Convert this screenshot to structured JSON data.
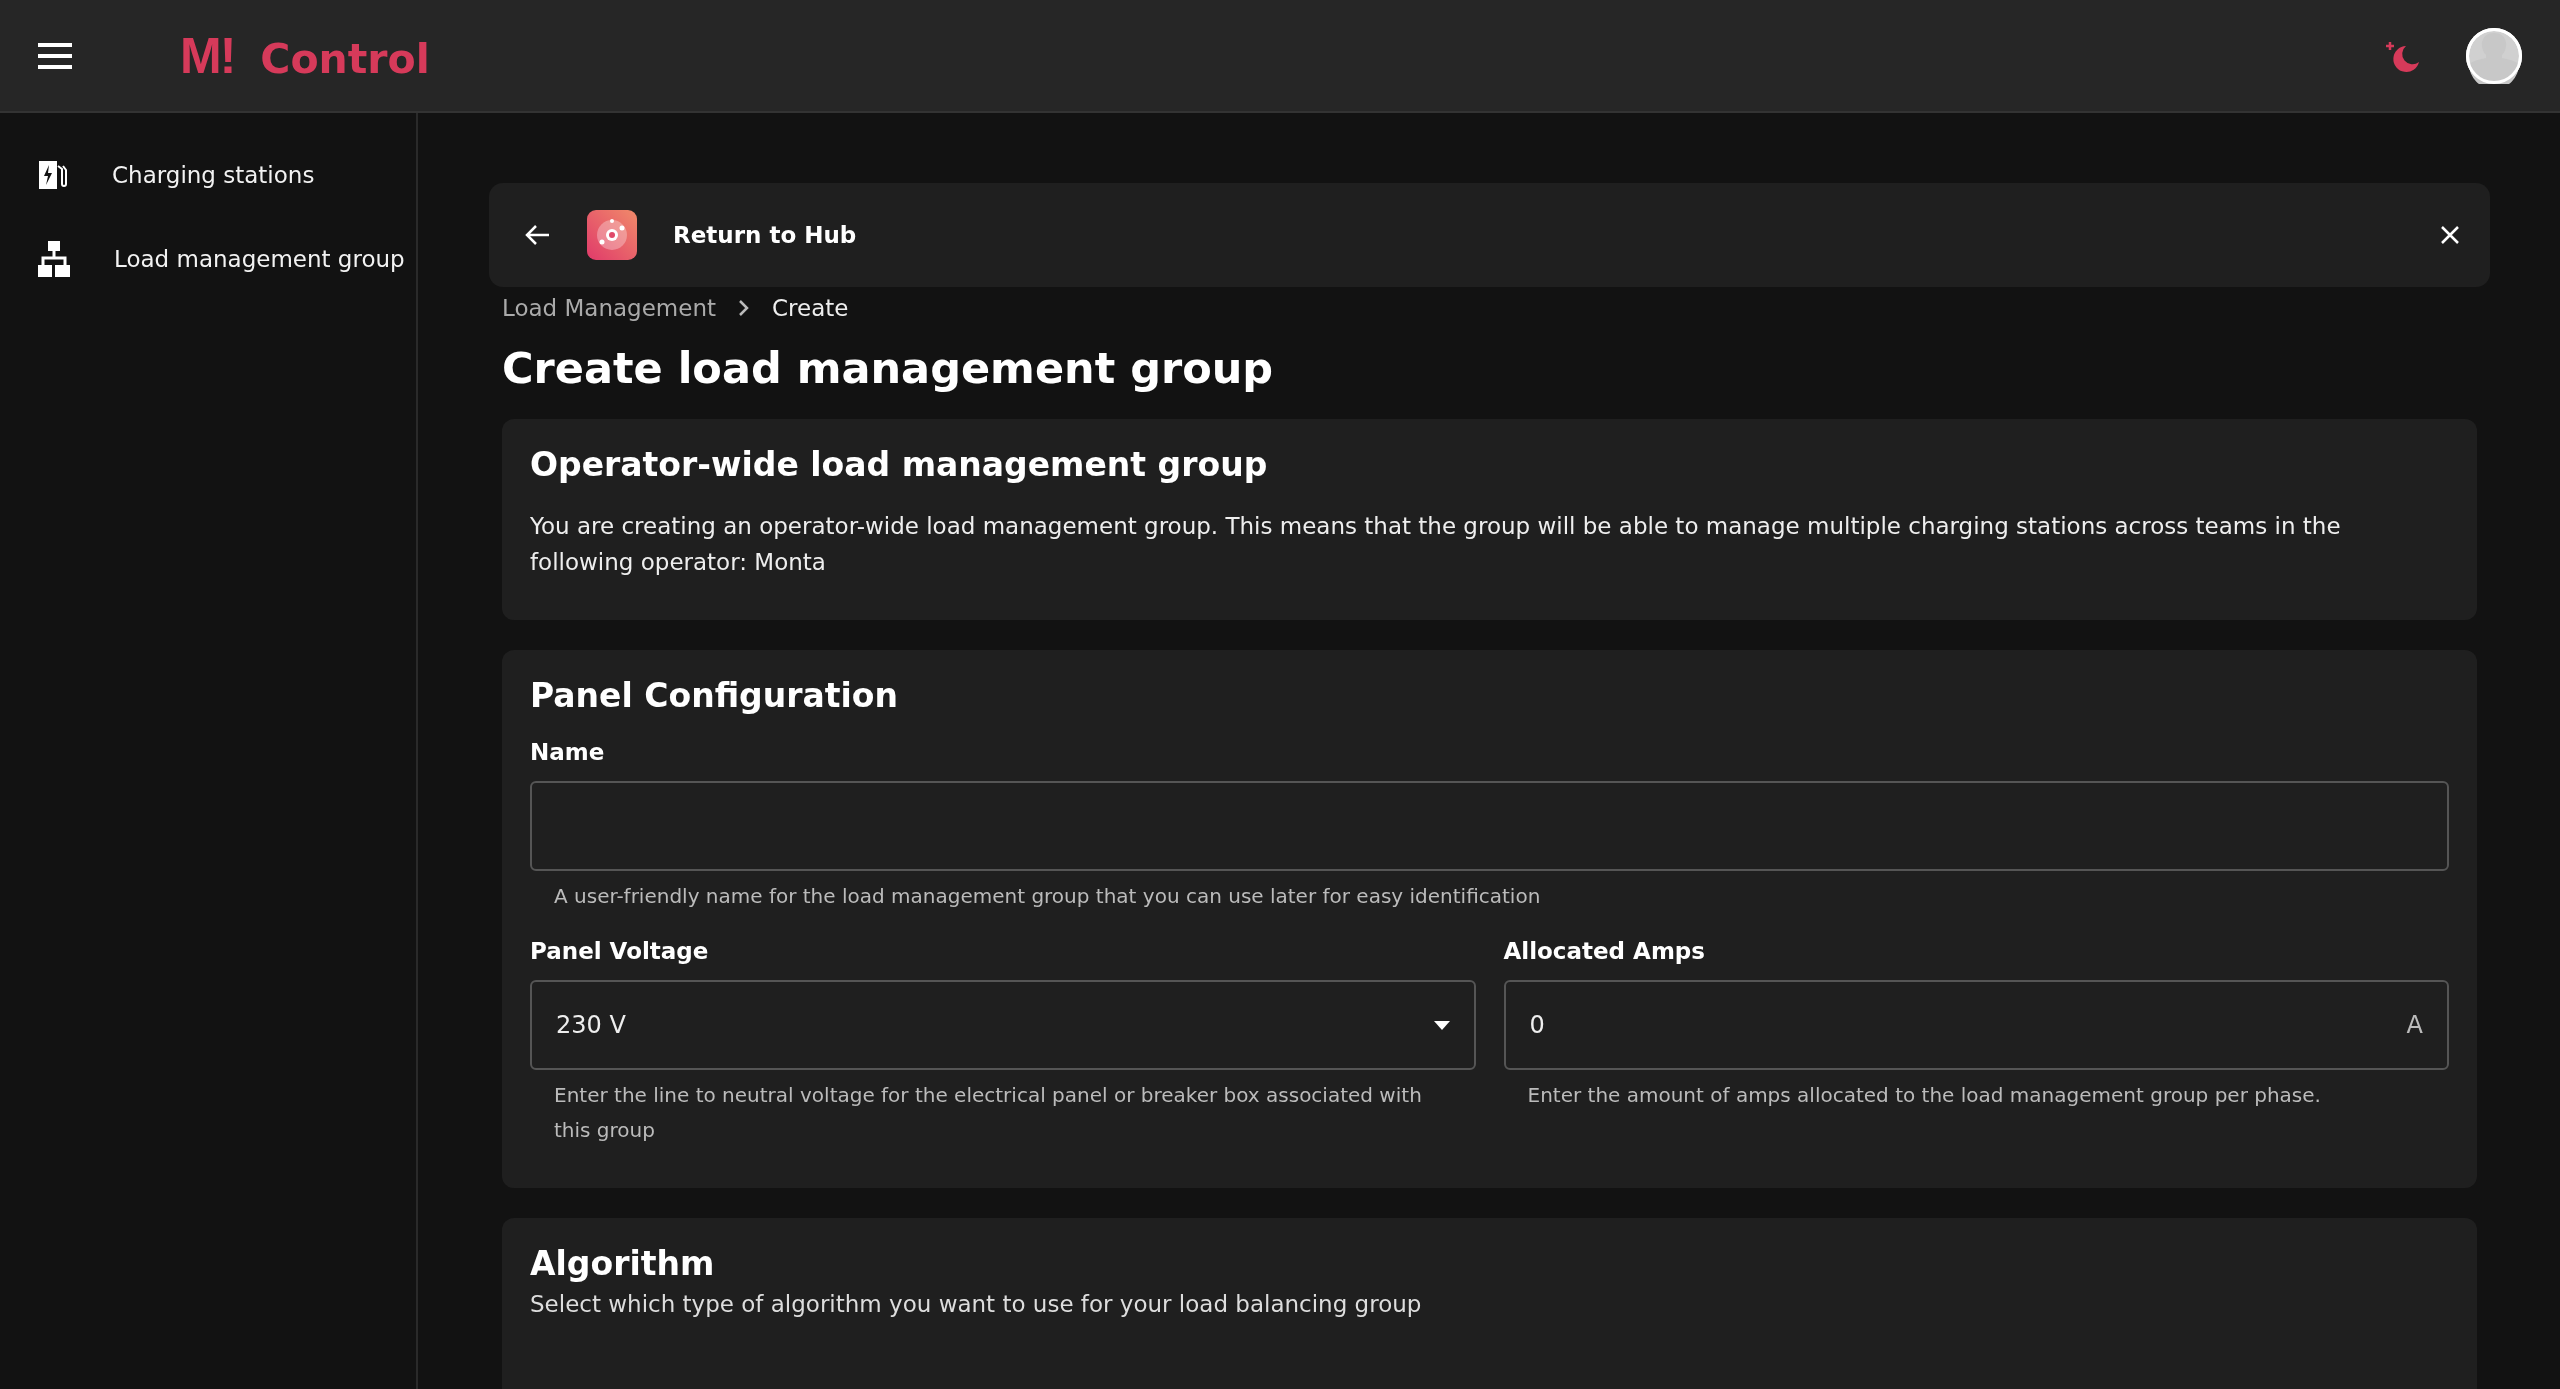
{
  "header": {
    "logo_mark": "M",
    "logo_dot": "!",
    "app_name": "Control"
  },
  "sidebar": {
    "items": [
      {
        "label": "Charging stations",
        "kind": "station"
      },
      {
        "label": "Load management group",
        "kind": "group"
      }
    ]
  },
  "hub_bar": {
    "label": "Return to Hub"
  },
  "breadcrumb": [
    "Load Management",
    "Create"
  ],
  "page_title": "Create load management group",
  "notice": {
    "title": "Operator-wide load management group",
    "text": "You are creating an operator-wide load management group. This means that the group will be able to manage multiple charging stations across teams in the following operator: Monta"
  },
  "panel": {
    "title": "Panel Configuration",
    "name_field": {
      "label": "Name",
      "help": "A user-friendly name for the load management group that you can use later for easy identification"
    },
    "voltage_field": {
      "label": "Panel Voltage",
      "value": "230 V",
      "help": "Enter the line to neutral voltage for the electrical panel or breaker box associated with this group"
    },
    "amps_field": {
      "label": "Allocated Amps",
      "value": "0",
      "unit": "A",
      "help": "Enter the amount of amps allocated to the load management group per phase."
    }
  },
  "algorithm": {
    "title": "Algorithm",
    "text": "Select which type of algorithm you want to use for your load balancing group"
  }
}
